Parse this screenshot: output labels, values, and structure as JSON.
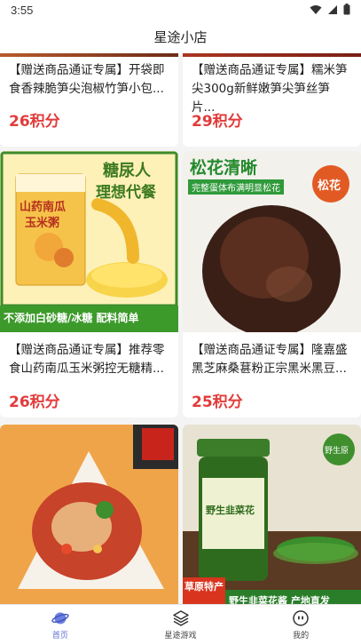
{
  "status_bar": {
    "time": "3:55"
  },
  "app_title": "星途小店",
  "products": [
    {
      "desc": "【赠送商品通证专属】开袋即食香辣脆笋尖泡椒竹笋小包...",
      "price": "26积分"
    },
    {
      "desc": "【赠送商品通证专属】糯米笋尖300g新鲜嫩笋尖笋丝笋片...",
      "price": "29积分"
    },
    {
      "desc": "【赠送商品通证专属】推荐零食山药南瓜玉米粥控无糖精...",
      "price": "26积分",
      "image_text": {
        "headline1": "糖尿人",
        "headline2": "理想代餐",
        "pack1": "山药南瓜",
        "pack2": "玉米粥",
        "banner": "不添加白砂糖/冰糖  配料简单"
      }
    },
    {
      "desc": "【赠送商品通证专属】隆嘉盛黑芝麻桑葚粉正宗黑米黑豆...",
      "price": "25积分",
      "image_text": {
        "headline": "松花清晰",
        "sub": "完整蛋体布满明显松花",
        "badge": "松花"
      }
    },
    {
      "image_text": {}
    },
    {
      "image_text": {
        "jar_label": "野生韭菜花",
        "badge_green": "野生原",
        "corner": "草原特产",
        "banner": "野生韭菜花酱 产地直发"
      }
    }
  ],
  "bottom_nav": [
    {
      "label": "首页",
      "icon": "planet-icon",
      "active": true
    },
    {
      "label": "星途游戏",
      "icon": "layers-icon",
      "active": false
    },
    {
      "label": "我的",
      "icon": "face-icon",
      "active": false
    }
  ],
  "colors": {
    "price": "#e23b3b",
    "nav_active": "#5c6fd6"
  }
}
